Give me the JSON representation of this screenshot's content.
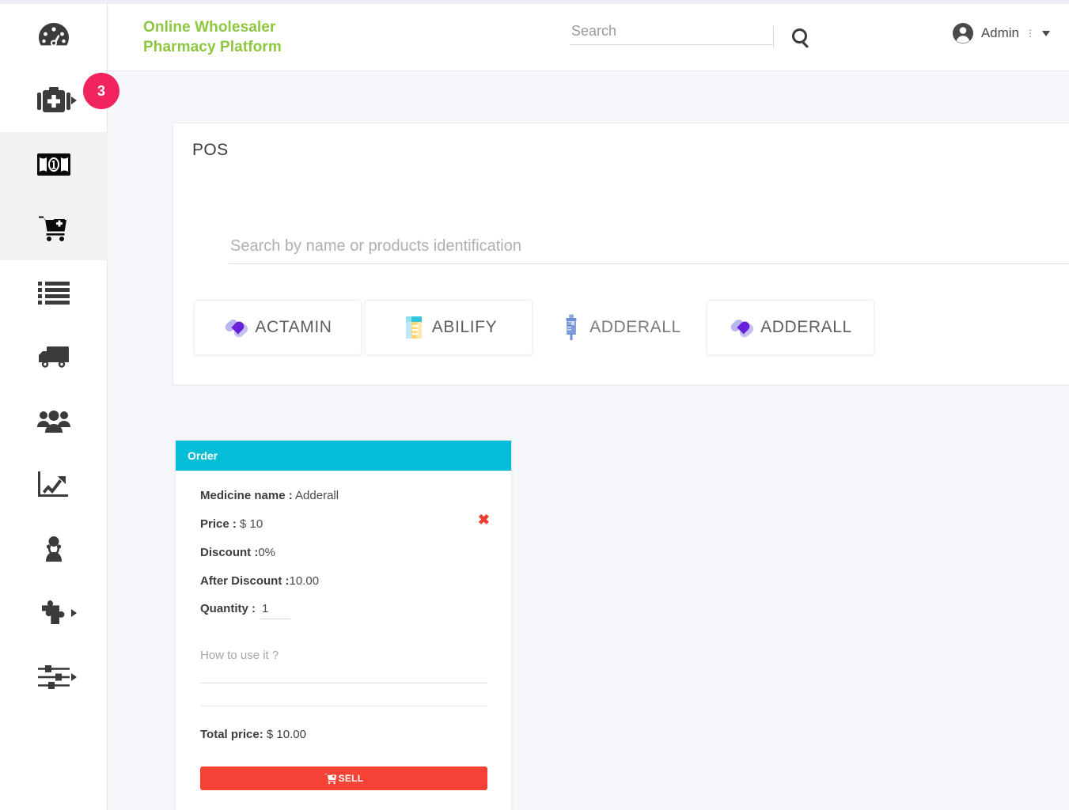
{
  "brand": {
    "line1": "Online Wholesaler",
    "line2": "Pharmacy Platform",
    "color": "#8dc63f"
  },
  "header": {
    "search_placeholder": "Search",
    "search_value": "",
    "search_icon": "search-icon",
    "user_name": "Admin",
    "user_dots": "⋮",
    "avatar_icon": "user-circle-icon",
    "caret_icon": "chevron-down-icon"
  },
  "sidebar": {
    "items": [
      {
        "name": "dashboard",
        "icon": "speedometer-icon",
        "active": false,
        "caret": false,
        "badge": null
      },
      {
        "name": "medicine",
        "icon": "medical-kit-icon",
        "active": false,
        "caret": true,
        "badge": "3"
      },
      {
        "name": "payments",
        "icon": "banknote-icon",
        "active": true,
        "caret": false,
        "badge": null
      },
      {
        "name": "pos",
        "icon": "cart-plus-icon",
        "active": true,
        "caret": false,
        "badge": null
      },
      {
        "name": "orders-list",
        "icon": "list-icon",
        "active": false,
        "caret": false,
        "badge": null
      },
      {
        "name": "shipping",
        "icon": "truck-icon",
        "active": false,
        "caret": false,
        "badge": null
      },
      {
        "name": "customers",
        "icon": "users-icon",
        "active": false,
        "caret": false,
        "badge": null
      },
      {
        "name": "reports",
        "icon": "chart-line-icon",
        "active": false,
        "caret": false,
        "badge": null
      },
      {
        "name": "doctors",
        "icon": "user-md-icon",
        "active": false,
        "caret": false,
        "badge": null
      },
      {
        "name": "extensions",
        "icon": "puzzle-piece-icon",
        "active": false,
        "caret": true,
        "badge": null
      },
      {
        "name": "settings",
        "icon": "sliders-icon",
        "active": false,
        "caret": true,
        "badge": null
      }
    ],
    "badge_color": "#f2245f"
  },
  "pos": {
    "title": "POS",
    "search_placeholder": "Search by name or products identification",
    "search_value": "",
    "products": [
      {
        "label": "ACTAMIN",
        "icon": "pill-capsule-icon",
        "carded": true
      },
      {
        "label": "ABILIFY",
        "icon": "pill-bottle-icon",
        "carded": true
      },
      {
        "label": "ADDERALL",
        "icon": "syringe-icon",
        "carded": false
      },
      {
        "label": "ADDERALL",
        "icon": "pill-capsule-icon",
        "carded": true
      }
    ]
  },
  "order": {
    "header_title": "Order",
    "header_color": "#06bdd8",
    "close_icon": "close-icon",
    "medicine_label": "Medicine name :",
    "medicine_value": "Adderall",
    "price_label": "Price :",
    "price_value": "$ 10",
    "discount_label": "Discount :",
    "discount_value": "0%",
    "after_discount_label": "After Discount :",
    "after_discount_value": "10.00",
    "quantity_label": "Quantity :",
    "quantity_value": "1",
    "howto_placeholder": "How to use it ?",
    "howto_value": "",
    "total_label": "Total price:",
    "total_value": "$ 10.00",
    "sell_label": "SELL",
    "sell_icon": "cart-plus-icon",
    "sell_color": "#f44336"
  }
}
